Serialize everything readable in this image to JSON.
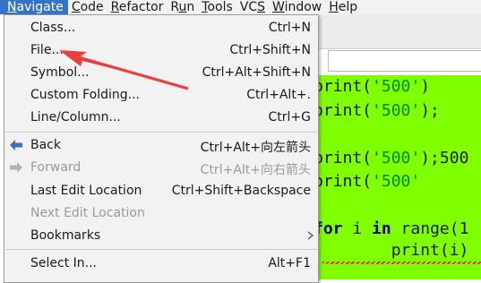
{
  "menubar": {
    "items": [
      {
        "label": "Navigate",
        "mnemonic_first": "N",
        "rest": "avigate"
      },
      {
        "label": "Code",
        "mnemonic_first": "C",
        "rest": "ode"
      },
      {
        "label": "Refactor",
        "mnemonic_first": "R",
        "rest": "efactor"
      },
      {
        "label": "Run",
        "pre": "R",
        "mnemonic": "u",
        "post": "n"
      },
      {
        "label": "Tools",
        "mnemonic_first": "T",
        "rest": "ools"
      },
      {
        "label": "VCS",
        "pre": "VC",
        "mnemonic": "S",
        "post": ""
      },
      {
        "label": "Window",
        "mnemonic_first": "W",
        "rest": "indow"
      },
      {
        "label": "Help",
        "mnemonic_first": "H",
        "rest": "elp"
      }
    ]
  },
  "menu": {
    "class": {
      "label": "Class...",
      "shortcut": "Ctrl+N"
    },
    "file": {
      "label": "File...",
      "shortcut": "Ctrl+Shift+N"
    },
    "symbol": {
      "label": "Symbol...",
      "shortcut": "Ctrl+Alt+Shift+N"
    },
    "custom_folding": {
      "label": "Custom Folding...",
      "shortcut": "Ctrl+Alt+."
    },
    "line_column": {
      "label": "Line/Column...",
      "shortcut": "Ctrl+G"
    },
    "back": {
      "label": "Back",
      "shortcut": "Ctrl+Alt+向左箭头"
    },
    "forward": {
      "label": "Forward",
      "shortcut": "Ctrl+Alt+向右箭头"
    },
    "last_edit": {
      "label": "Last Edit Location",
      "shortcut": "Ctrl+Shift+Backspace"
    },
    "next_edit": {
      "label": "Next Edit Location",
      "shortcut": ""
    },
    "bookmarks": {
      "label": "Bookmarks",
      "shortcut": ""
    },
    "select_in": {
      "label": "Select In...",
      "shortcut": "Alt+F1"
    }
  },
  "editor": {
    "lines": [
      {
        "pre": "print(",
        "str": "'500'",
        "post": ")"
      },
      {
        "pre": "print(",
        "str": "'500'",
        "post": ");"
      },
      {
        "pre": "print(",
        "str": "'500'",
        "post": ");500"
      },
      {
        "pre": "print(",
        "str": "'500'",
        "post": ""
      },
      {
        "kw1": "for",
        "mid": " i ",
        "kw2": "in",
        "post": " range(1"
      },
      {
        "pre": "        print(i)"
      }
    ]
  },
  "colors": {
    "menu_active_bg": "#3573c8",
    "editor_bg": "#7fff00",
    "annotation_arrow": "#e8413c",
    "icon_blue": "#3b6fc4",
    "icon_disabled": "#b3b3b3"
  }
}
